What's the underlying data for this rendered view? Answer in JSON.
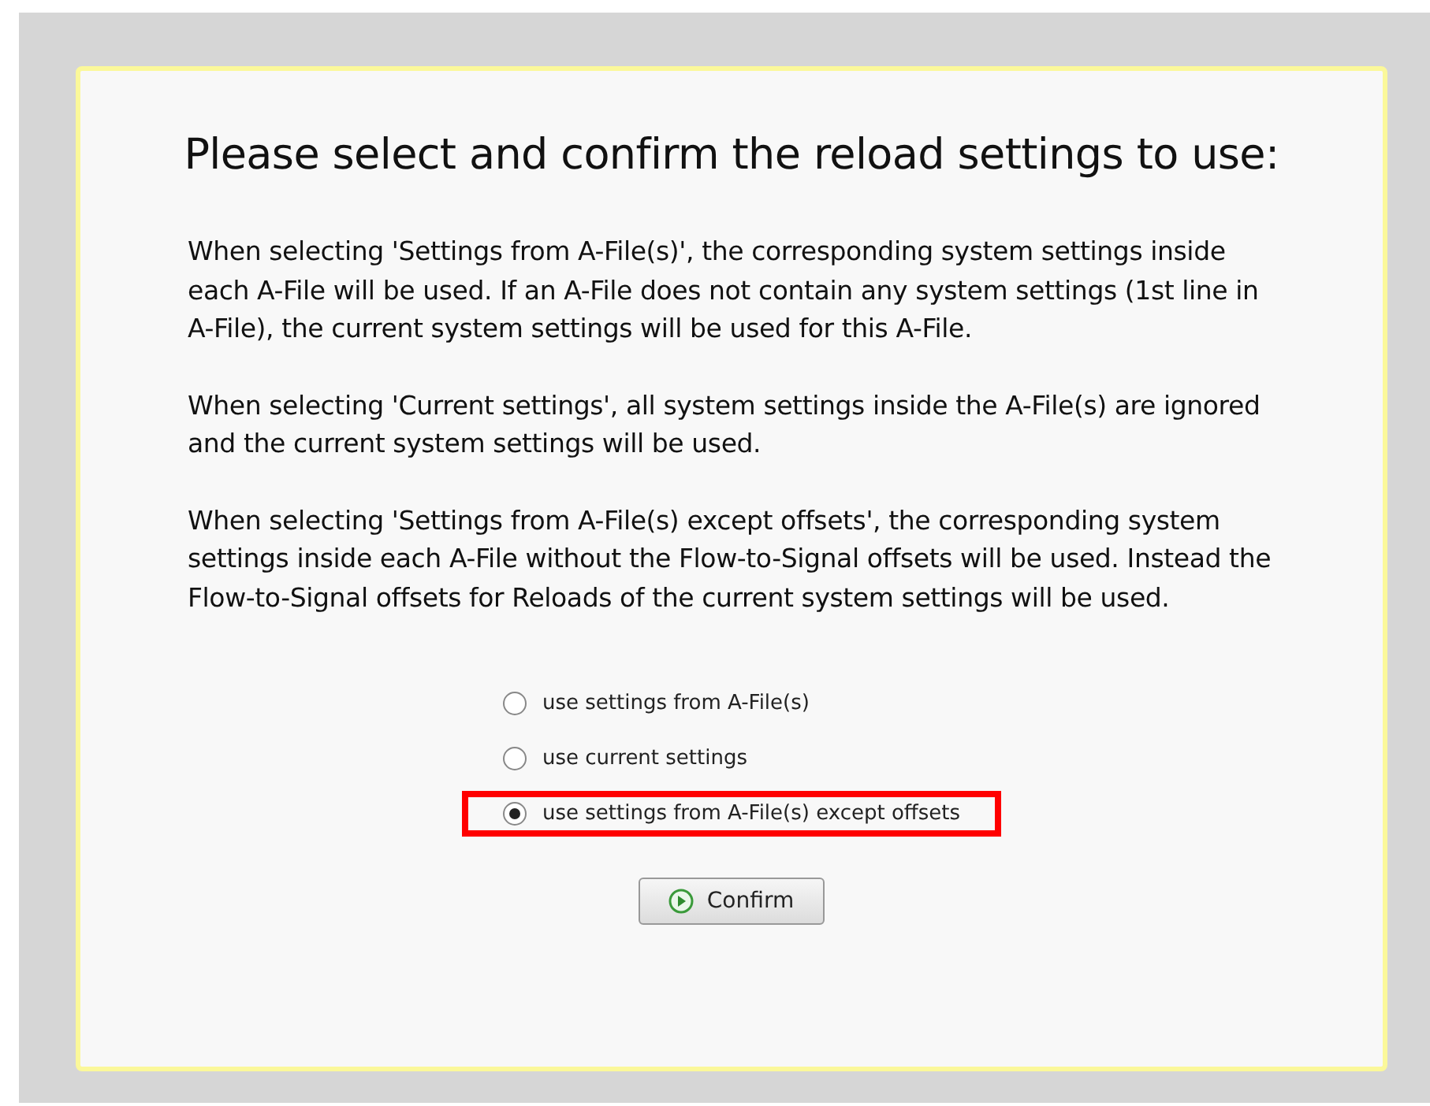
{
  "dialog": {
    "title": "Please select and confirm the reload settings to use:",
    "paragraphs": [
      "When selecting 'Settings from A-File(s)', the corresponding system settings inside each A-File will be used. If an A-File does not contain any system settings (1st line in A-File), the current system settings will be used for this A-File.",
      "When selecting 'Current settings', all system settings inside the A-File(s) are ignored and the current system settings will be used.",
      "When selecting 'Settings from A-File(s) except offsets', the corresponding system settings inside each A-File without the Flow-to-Signal offsets will be used. Instead the Flow-to-Signal offsets for Reloads of the current system settings will be used."
    ],
    "options": [
      {
        "label": "use settings from A-File(s)",
        "selected": false,
        "highlighted": false
      },
      {
        "label": "use current settings",
        "selected": false,
        "highlighted": false
      },
      {
        "label": "use settings from A-File(s) except offsets",
        "selected": true,
        "highlighted": true
      }
    ],
    "confirm_button": "Confirm"
  }
}
